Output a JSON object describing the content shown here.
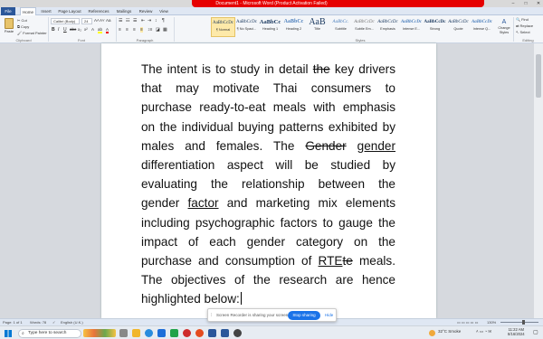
{
  "window": {
    "title": "Document1 - Microsoft Word (Product Activation Failed)"
  },
  "tabs": [
    "File",
    "Home",
    "Insert",
    "Page Layout",
    "References",
    "Mailings",
    "Review",
    "View"
  ],
  "clipboard": {
    "paste": "Paste",
    "cut": "Cut",
    "copy": "Copy",
    "format_painter": "Format Painter",
    "group": "Clipboard"
  },
  "font": {
    "name": "Calibri (Body)",
    "size": "24",
    "group": "Font"
  },
  "paragraph": {
    "group": "Paragraph"
  },
  "styles": {
    "items": [
      {
        "preview": "AaBbCcDc",
        "name": "¶ Normal"
      },
      {
        "preview": "AaBbCcDc",
        "name": "¶ No Spaci..."
      },
      {
        "preview": "AaBbCc",
        "name": "Heading 1"
      },
      {
        "preview": "AaBbCc",
        "name": "Heading 2"
      },
      {
        "preview": "AaB",
        "name": "Title"
      },
      {
        "preview": "AaBbCc.",
        "name": "Subtitle"
      },
      {
        "preview": "AaBbCcDc",
        "name": "Subtle Em..."
      },
      {
        "preview": "AaBbCcDc",
        "name": "Emphasis"
      },
      {
        "preview": "AaBbCcDc",
        "name": "Intense E..."
      },
      {
        "preview": "AaBbCcDc",
        "name": "Strong"
      },
      {
        "preview": "AaBbCcDc",
        "name": "Quote"
      },
      {
        "preview": "AaBbCcDc",
        "name": "Intense Q..."
      }
    ],
    "change_styles": "Change Styles",
    "group": "Styles"
  },
  "editing": {
    "find": "Find",
    "replace": "Replace",
    "select": "Select",
    "group": "Editing"
  },
  "document": {
    "t1": "The intent is to study in detail ",
    "d1": "the",
    "t2": " key drivers that may motivate Thai consumers to purchase ready-to-eat meals with emphasis on the individual buying patterns exhibited by males and females. The ",
    "d2": "Gender",
    "t3": " ",
    "i1": "gender",
    "t4": " differentiation aspect will be studied by evaluating the relationship between the gender ",
    "i2": "factor",
    "t5": " and marketing mix elements including psychographic factors to gauge the impact of each gender category on the purchase and consumption of ",
    "i3": "RTE",
    "d3": "te",
    "t6": " meals. The objectives of the research are hence highlighted below:"
  },
  "status": {
    "page": "Page: 1 of 1",
    "words": "Words: 78",
    "language": "English (U.K.)",
    "zoom": "130%"
  },
  "share_bar": {
    "message": "Screen Recorder is sharing your screen.",
    "stop": "Stop sharing",
    "hide": "Hide"
  },
  "taskbar": {
    "search_placeholder": "Type here to search",
    "weather": "32°C  Smoke",
    "time": "11:22 AM",
    "date": "8/16/2024"
  },
  "colors": {
    "title_red": "#e60000",
    "file_tab": "#2b579a",
    "stop_button": "#1a73e8"
  }
}
